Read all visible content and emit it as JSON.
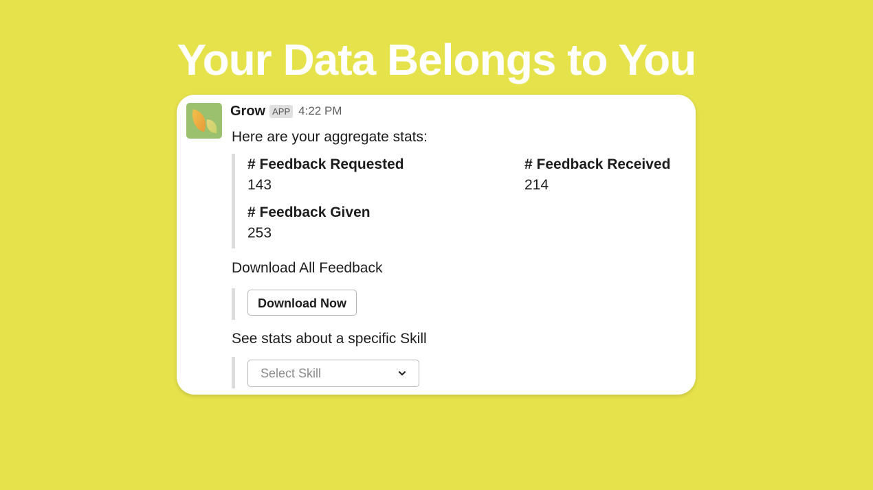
{
  "headline": "Your Data Belongs to You",
  "message": {
    "app_name": "Grow",
    "app_badge": "APP",
    "timestamp": "4:22 PM",
    "intro": "Here are your aggregate stats:",
    "stats": [
      {
        "label": "# Feedback Requested",
        "value": "143"
      },
      {
        "label": "# Feedback Received",
        "value": "214"
      },
      {
        "label": "# Feedback Given",
        "value": "253"
      }
    ],
    "download_text": "Download All Feedback",
    "download_button": "Download Now",
    "skill_text": "See stats about a specific Skill",
    "skill_select_placeholder": "Select Skill"
  },
  "colors": {
    "background": "#e6e24b",
    "card": "#ffffff",
    "avatar": "#9bc06e"
  }
}
